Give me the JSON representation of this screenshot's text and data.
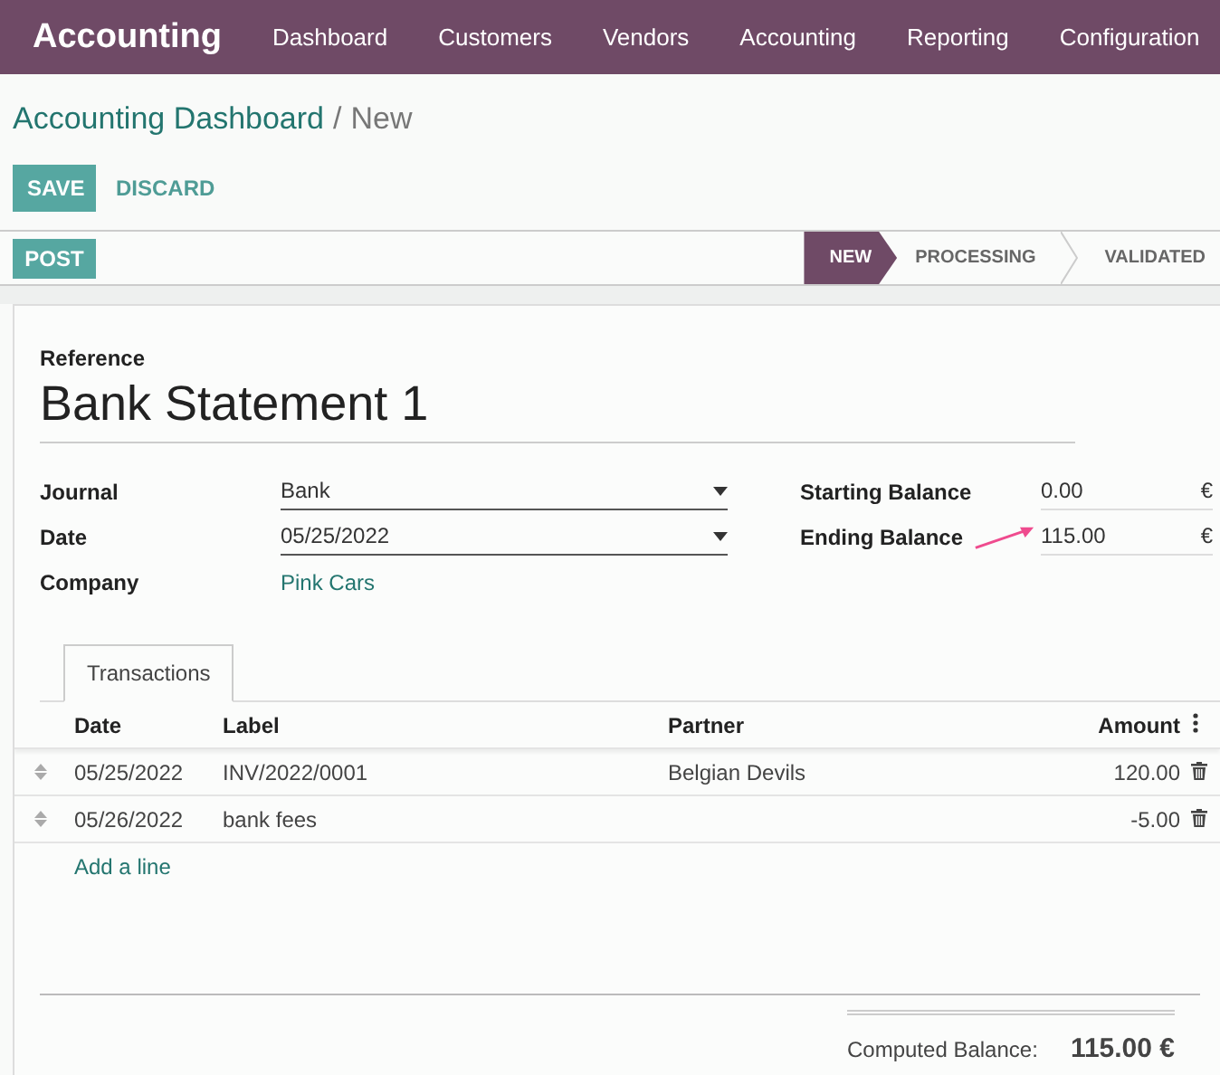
{
  "navbar": {
    "app": "Accounting",
    "menu": [
      "Dashboard",
      "Customers",
      "Vendors",
      "Accounting",
      "Reporting",
      "Configuration"
    ]
  },
  "breadcrumb": {
    "parent": "Accounting Dashboard",
    "separator": "/",
    "current": "New"
  },
  "buttons": {
    "save": "SAVE",
    "discard": "DISCARD",
    "post": "POST"
  },
  "stages": [
    {
      "label": "NEW",
      "selected": true
    },
    {
      "label": "PROCESSING",
      "selected": false
    },
    {
      "label": "VALIDATED",
      "selected": false
    }
  ],
  "form": {
    "reference_label": "Reference",
    "reference": "Bank Statement 1",
    "left_fields": [
      {
        "label": "Journal",
        "value": "Bank",
        "kind": "select"
      },
      {
        "label": "Date",
        "value": "05/25/2022",
        "kind": "select"
      },
      {
        "label": "Company",
        "value": "Pink Cars",
        "kind": "link"
      }
    ],
    "right_fields": [
      {
        "label": "Starting Balance",
        "value": "0.00",
        "currency": "€",
        "highlighted": false
      },
      {
        "label": "Ending Balance",
        "value": "115.00",
        "currency": "€",
        "highlighted": true
      }
    ]
  },
  "tabs": [
    {
      "label": "Transactions",
      "selected": true
    }
  ],
  "table": {
    "columns": [
      "Date",
      "Label",
      "Partner",
      "Amount"
    ],
    "rows": [
      {
        "date": "05/25/2022",
        "label": "INV/2022/0001",
        "partner": "Belgian Devils",
        "amount": "120.00"
      },
      {
        "date": "05/26/2022",
        "label": "bank fees",
        "partner": "",
        "amount": "-5.00"
      }
    ],
    "add_line": "Add a line"
  },
  "computed_balance": {
    "label": "Computed Balance:",
    "value": "115.00 €"
  }
}
